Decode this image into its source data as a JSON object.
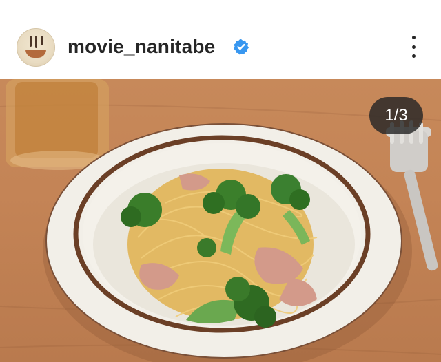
{
  "post": {
    "username": "movie_nanitabe",
    "verified": true,
    "carousel_counter": "1/3"
  },
  "icons": {
    "verified": "verified-badge-icon",
    "more": "more-options-icon"
  },
  "colors": {
    "verified_blue": "#3897f0",
    "text": "#262626"
  }
}
